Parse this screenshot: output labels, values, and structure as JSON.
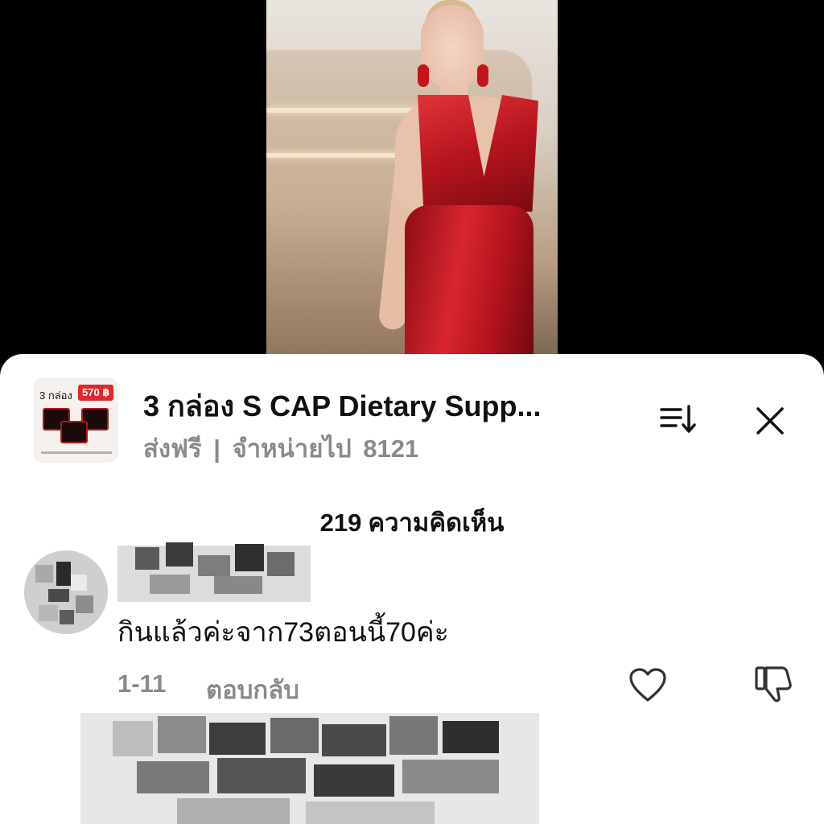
{
  "video": {
    "description_alt": ""
  },
  "product": {
    "thumb_count": "3 กล่อง",
    "thumb_price": "570 ฿",
    "title": "3 กล่อง S CAP Dietary Supp...",
    "shipping": "ส่งฟรี",
    "separator": "|",
    "sold_label": "จำหน่ายไป",
    "sold_count": "8121"
  },
  "header_icons": {
    "sort": "sort-icon",
    "close": "close-icon"
  },
  "comments": {
    "count": "219",
    "label": "ความคิดเห็น",
    "items": [
      {
        "text": "กินแล้วค่ะจาก73ตอนนี้70ค่ะ",
        "date": "1-11",
        "reply_label": "ตอบกลับ"
      }
    ]
  },
  "colors": {
    "price_badge": "#e02a2a",
    "dress": "#b5141d",
    "meta_text": "#8a8a8a"
  }
}
